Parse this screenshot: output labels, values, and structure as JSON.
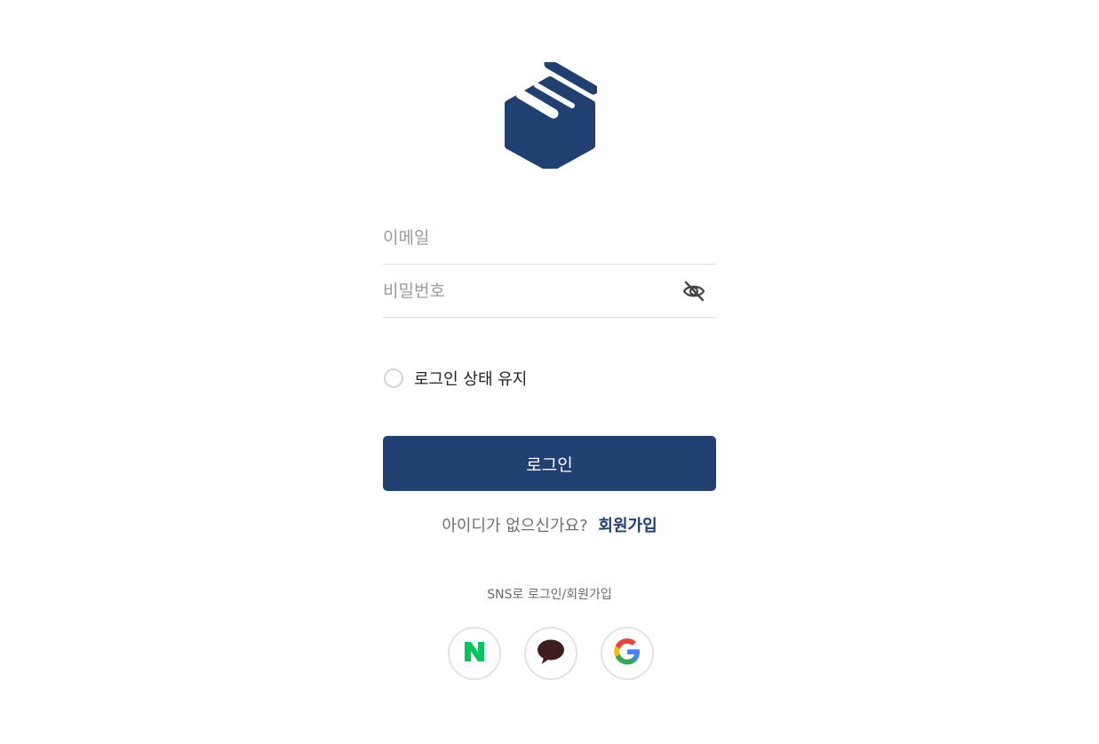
{
  "brand": {
    "logo_icon": "box-logo-icon",
    "color": "#1f4070"
  },
  "login_form": {
    "email_placeholder": "이메일",
    "password_placeholder": "비밀번호",
    "password_toggle_icon": "eye-off-icon",
    "keep_logged_in_label": "로그인 상태 유지",
    "keep_logged_in_checked": false,
    "submit_label": "로그인"
  },
  "signup": {
    "prompt": "아이디가 없으신가요?",
    "link_label": "회원가입"
  },
  "sns": {
    "title": "SNS로 로그인/회원가입",
    "providers": [
      {
        "icon": "naver-icon",
        "color": "#03c75a"
      },
      {
        "icon": "kakao-icon",
        "color": "#3c1e1e"
      },
      {
        "icon": "google-icon",
        "color": "#4285f4"
      }
    ]
  }
}
